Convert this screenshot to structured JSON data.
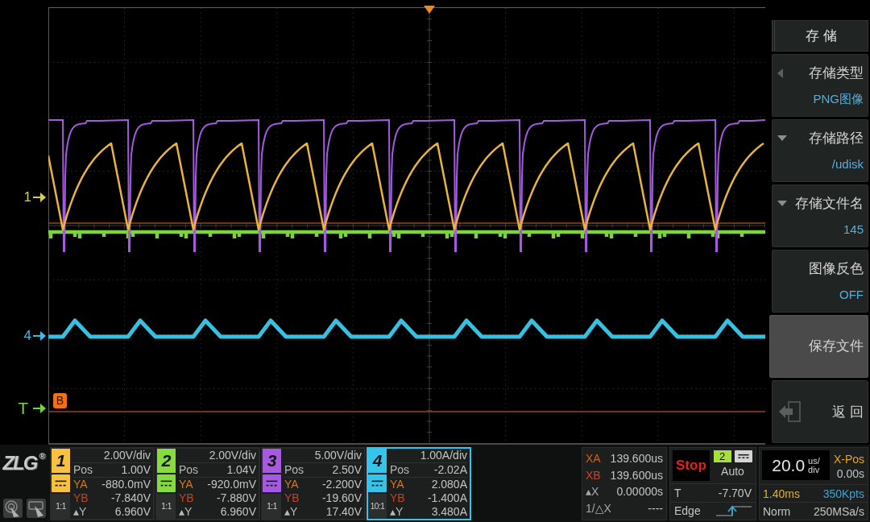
{
  "display": {
    "markers": [
      {
        "kind": "channel",
        "label": "1",
        "color": "#d4d24c"
      },
      {
        "kind": "channel",
        "label": "4",
        "color": "#38bfe0"
      },
      {
        "kind": "trigger",
        "label": "T",
        "color": "#6fd83e"
      }
    ],
    "cursor_b_label": "B"
  },
  "menu": {
    "title": "存 储",
    "items": [
      {
        "kind": "cycle",
        "label": "存储类型",
        "value": "PNG图像",
        "selected": false
      },
      {
        "kind": "dropdown",
        "label": "存储路径",
        "value": "/udisk",
        "selected": false
      },
      {
        "kind": "dropdown",
        "label": "存储文件名",
        "value": "145",
        "selected": false
      },
      {
        "kind": "plain",
        "label": "图像反色",
        "value": "OFF",
        "selected": false
      },
      {
        "kind": "plain",
        "label": "保存文件",
        "selected": true
      },
      {
        "kind": "back",
        "label": "返 回",
        "selected": false
      }
    ]
  },
  "status_bar": {
    "logo": {
      "text": "ZLG",
      "mark": "®"
    },
    "channels": [
      {
        "number": "1",
        "color": "#f6c23f",
        "selected": false,
        "scale": "2.00V/div",
        "probe": "1:1",
        "readings": [
          {
            "kind": "pos",
            "label": "Pos",
            "value": "1.00V"
          },
          {
            "kind": "ya",
            "label": "YA",
            "value": "-880.0mV"
          },
          {
            "kind": "yb",
            "label": "YB",
            "value": "-7.840V"
          },
          {
            "kind": "dy",
            "label": "▴Y",
            "value": "6.960V"
          }
        ]
      },
      {
        "number": "2",
        "color": "#86dc3e",
        "selected": false,
        "scale": "2.00V/div",
        "probe": "1:1",
        "readings": [
          {
            "kind": "pos",
            "label": "Pos",
            "value": "1.04V"
          },
          {
            "kind": "ya",
            "label": "YA",
            "value": "-920.0mV"
          },
          {
            "kind": "yb",
            "label": "YB",
            "value": "-7.880V"
          },
          {
            "kind": "dy",
            "label": "▴Y",
            "value": "6.960V"
          }
        ]
      },
      {
        "number": "3",
        "color": "#a45be0",
        "selected": false,
        "scale": "5.00V/div",
        "probe": "1:1",
        "readings": [
          {
            "kind": "pos",
            "label": "Pos",
            "value": "2.50V"
          },
          {
            "kind": "ya",
            "label": "YA",
            "value": "-2.200V"
          },
          {
            "kind": "yb",
            "label": "YB",
            "value": "-19.60V"
          },
          {
            "kind": "dy",
            "label": "▴Y",
            "value": "17.40V"
          }
        ]
      },
      {
        "number": "4",
        "color": "#36c5ea",
        "selected": true,
        "scale": "1.00A/div",
        "probe": "10:1",
        "readings": [
          {
            "kind": "pos",
            "label": "Pos",
            "value": "-2.02A"
          },
          {
            "kind": "ya",
            "label": "YA",
            "value": "2.080A"
          },
          {
            "kind": "yb",
            "label": "YB",
            "value": "-1.400A"
          },
          {
            "kind": "dy",
            "label": "▴Y",
            "value": "3.480A"
          }
        ]
      }
    ],
    "cursors": [
      {
        "kind": "xa",
        "label": "XA",
        "value": "139.600us"
      },
      {
        "kind": "xb",
        "label": "XB",
        "value": "139.600us"
      },
      {
        "kind": "dx",
        "label": "▴X",
        "value": "0.00000s"
      },
      {
        "kind": "inv",
        "label": "1/△X",
        "value": "----"
      }
    ],
    "trigger": {
      "state": "Stop",
      "source": "2",
      "color": "#a6e03a",
      "mode": "Auto",
      "level_label": "T",
      "level_value": "-7.70V",
      "type": "Edge"
    },
    "timebase": {
      "scale": "20.0",
      "unit_top": "us/",
      "unit_bottom": "div",
      "xpos_label": "X-Pos",
      "xpos": "0.00s",
      "duration": "1.40ms",
      "points": "350Kpts",
      "acq_mode": "Norm",
      "sample_rate": "250MSa/s"
    }
  }
}
